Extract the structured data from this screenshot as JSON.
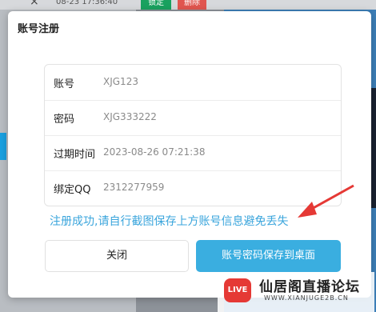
{
  "background": {
    "top_text": "08-23 17:36:40",
    "lock_label": "锁定",
    "delete_label": "删除",
    "close_glyph": "×"
  },
  "dialog": {
    "title": "账号注册",
    "rows": [
      {
        "label": "账号",
        "value": "XJG123"
      },
      {
        "label": "密码",
        "value": "XJG333222"
      },
      {
        "label": "过期时间",
        "value": "2023-08-26 07:21:38"
      },
      {
        "label": "绑定QQ",
        "value": "2312277959"
      }
    ],
    "notice": "注册成功,请自行截图保存上方账号信息避免丢失",
    "close_button": "关闭",
    "save_button": "账号密码保存到桌面"
  },
  "watermark": {
    "logo": "LIVE",
    "title": "仙居阁直播论坛",
    "url": "WWW.XIANJUGE2B.CN"
  },
  "colors": {
    "accent": "#3aaee0",
    "arrow": "#e53935"
  }
}
